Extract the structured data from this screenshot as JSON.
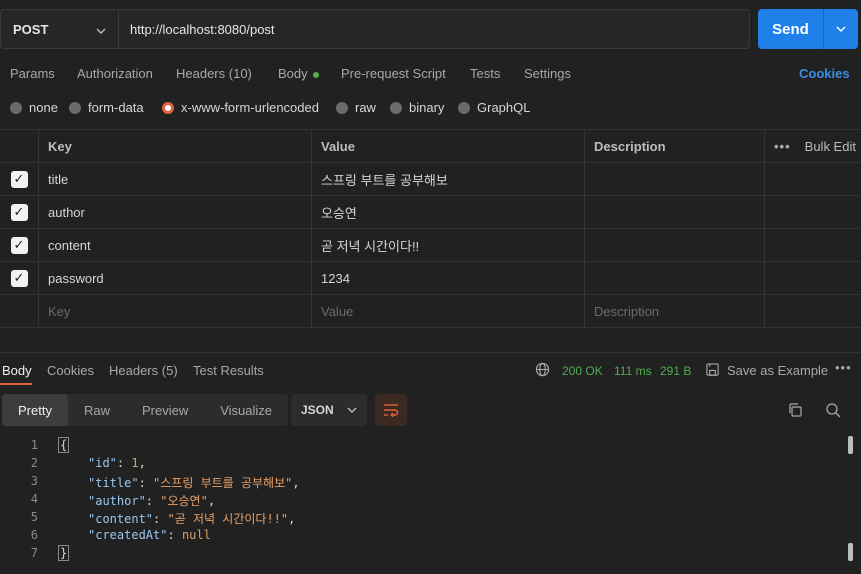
{
  "request": {
    "method": "POST",
    "url": "http://localhost:8080/post",
    "send_label": "Send"
  },
  "request_tabs": {
    "params": "Params",
    "authorization": "Authorization",
    "headers": "Headers",
    "headers_count": "(10)",
    "body": "Body",
    "pre_request": "Pre-request Script",
    "tests": "Tests",
    "settings": "Settings",
    "cookies": "Cookies"
  },
  "body_types": {
    "none": "none",
    "form_data": "form-data",
    "urlencoded": "x-www-form-urlencoded",
    "raw": "raw",
    "binary": "binary",
    "graphql": "GraphQL",
    "selected": "x-www-form-urlencoded"
  },
  "params_table": {
    "headers": {
      "key": "Key",
      "value": "Value",
      "description": "Description",
      "bulk_edit": "Bulk Edit"
    },
    "rows": [
      {
        "key": "title",
        "value": "스프링 부트를 공부해보",
        "checked": true
      },
      {
        "key": "author",
        "value": "오승연",
        "checked": true
      },
      {
        "key": "content",
        "value": "곧 저녁 시간이다!!",
        "checked": true
      },
      {
        "key": "password",
        "value": "1234",
        "checked": true
      }
    ],
    "placeholders": {
      "key": "Key",
      "value": "Value",
      "description": "Description"
    }
  },
  "response_tabs": {
    "body": "Body",
    "cookies": "Cookies",
    "headers": "Headers",
    "headers_count": "(5)",
    "test_results": "Test Results"
  },
  "response_status": {
    "status": "200 OK",
    "time": "111 ms",
    "size": "291 B",
    "save_example": "Save as Example"
  },
  "view_modes": {
    "pretty": "Pretty",
    "raw": "Raw",
    "preview": "Preview",
    "visualize": "Visualize",
    "format": "JSON"
  },
  "response_body": {
    "line_numbers": [
      "1",
      "2",
      "3",
      "4",
      "5",
      "6",
      "7"
    ],
    "open_brace": "{",
    "close_brace": "}",
    "fields": [
      {
        "key": "\"id\"",
        "value": "1",
        "comma": ","
      },
      {
        "key": "\"title\"",
        "value": "\"스프링 부트를 공부해보\"",
        "comma": ","
      },
      {
        "key": "\"author\"",
        "value": "\"오승연\"",
        "comma": ","
      },
      {
        "key": "\"content\"",
        "value": "\"곧 저녁 시간이다!!\"",
        "comma": ","
      },
      {
        "key": "\"createdAt\"",
        "value": "null",
        "comma": ""
      }
    ]
  },
  "colors": {
    "background": "#212121",
    "accent": "#e0633c",
    "send": "#1f80e9",
    "status_green": "#4caf50",
    "link_blue": "#3b8fe6"
  }
}
